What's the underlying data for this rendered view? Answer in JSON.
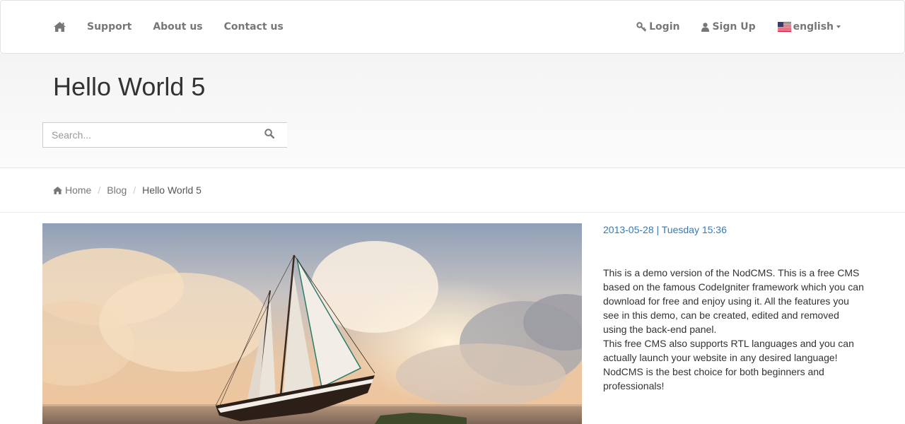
{
  "nav": {
    "home_icon": "home-icon",
    "left_links": [
      "Support",
      "About us",
      "Contact us"
    ],
    "login_label": "Login",
    "login_icon": "key-icon",
    "signup_label": "Sign Up",
    "signup_icon": "user-icon",
    "language_label": "english",
    "language_icon": "us-flag-icon"
  },
  "header": {
    "title": "Hello World 5",
    "search_placeholder": "Search...",
    "search_icon": "search-icon"
  },
  "breadcrumb": {
    "home": "Home",
    "blog": "Blog",
    "current": "Hello World 5"
  },
  "post": {
    "date": "2013-05-28 | Tuesday 15:36",
    "paragraph_1": "This is a demo version of the NodCMS. This is a free CMS based on the famous CodeIgniter framework which you can download for free and enjoy using it. All the features you see in this demo, can be created, edited and removed using the back-end panel.",
    "paragraph_2": "This free CMS also supports RTL languages and you can actually launch your website in any desired language!",
    "paragraph_3": "NodCMS is the best choice for both beginners and professionals!"
  },
  "colors": {
    "nav_text": "#777777",
    "link_blue": "#337ab7",
    "header_bg": "#f7f7f7"
  }
}
